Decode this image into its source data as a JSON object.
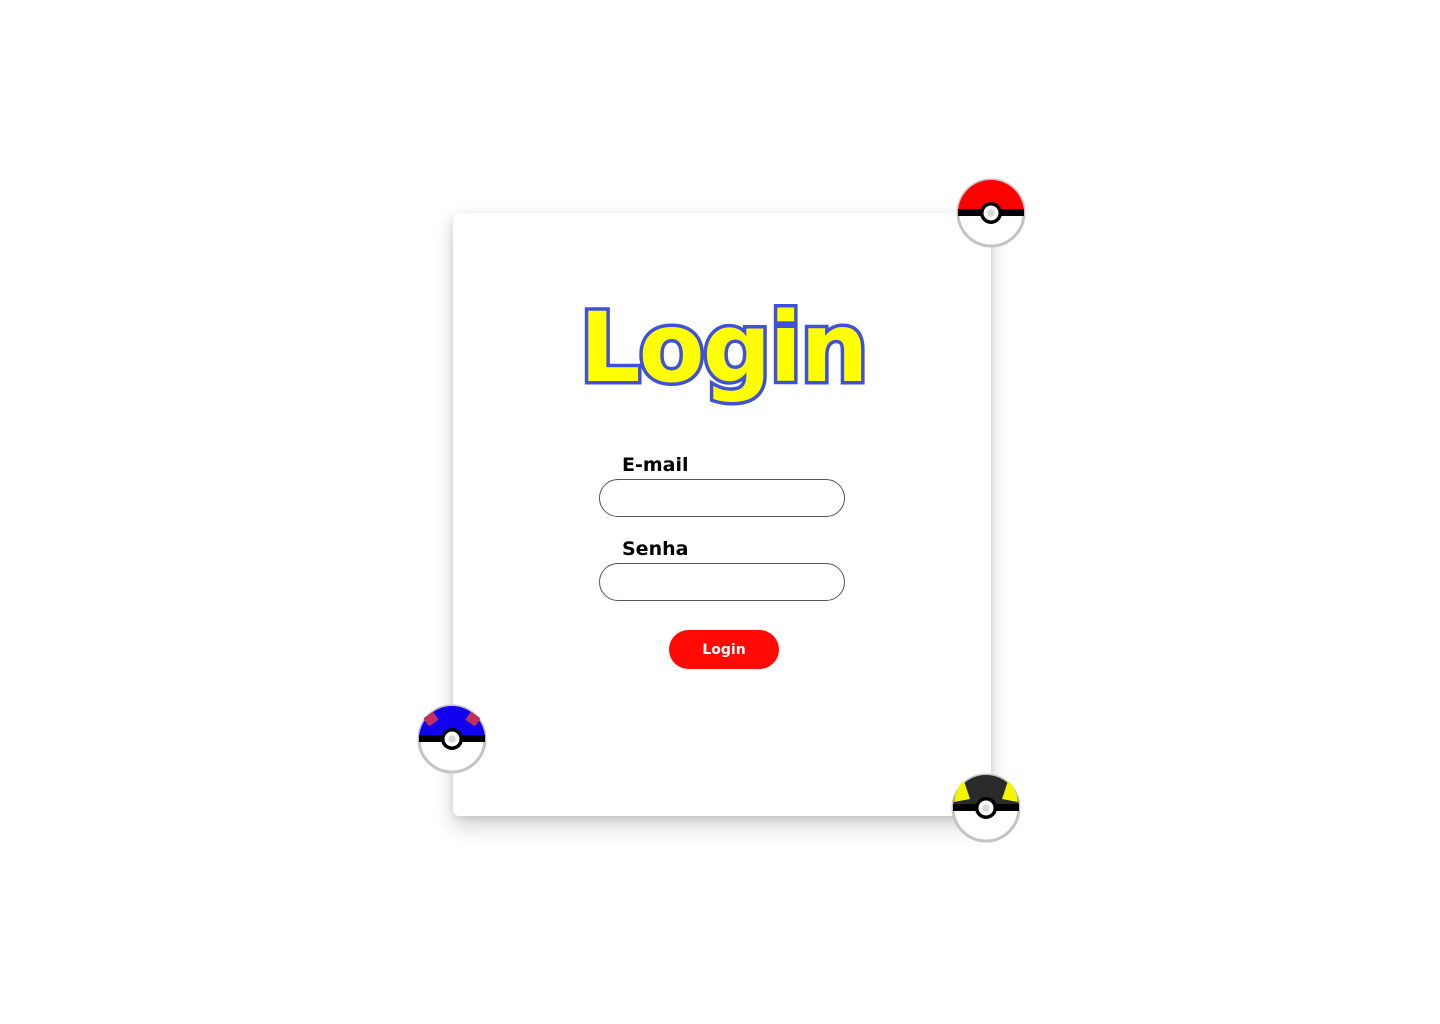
{
  "page": {
    "title": "Login"
  },
  "form": {
    "email_label": "E-mail",
    "email_value": "",
    "password_label": "Senha",
    "password_value": "",
    "submit_label": "Login"
  },
  "colors": {
    "button": "#ff0a07",
    "logo_fill": "#ffff00",
    "logo_stroke": "#3f51d9",
    "great_ball": "#1100f0",
    "great_ball_marks": "#c0305f",
    "ultra_ball_band": "#f5f500"
  },
  "icons": {
    "red_ball": "poke-ball-icon",
    "blue_ball": "great-ball-icon",
    "yellow_ball": "ultra-ball-icon"
  }
}
